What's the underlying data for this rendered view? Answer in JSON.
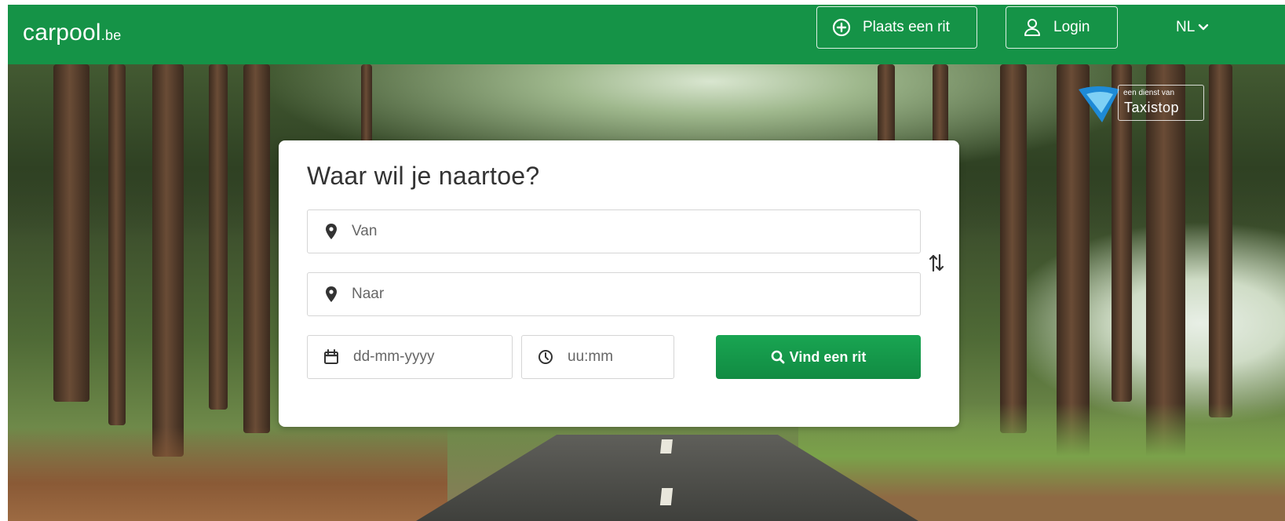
{
  "header": {
    "logo_main": "carpool",
    "logo_tld": ".be",
    "place_ride_label": "Plaats een rit",
    "login_label": "Login",
    "language": "NL",
    "brand_color": "#159347"
  },
  "badge": {
    "small_text": "een dienst van",
    "brand_text": "Taxistop"
  },
  "search": {
    "title": "Waar wil je naartoe?",
    "from_placeholder": "Van",
    "to_placeholder": "Naar",
    "date_placeholder": "dd-mm-yyyy",
    "time_placeholder": "uu:mm",
    "submit_label": "Vind een rit"
  },
  "icons": {
    "place_ride": "plus-circle-icon",
    "login": "user-icon",
    "language": "chevron-down-icon",
    "from": "map-marker-icon",
    "to": "map-marker-icon",
    "swap": "swap-vertical-icon",
    "date": "calendar-icon",
    "time": "clock-icon",
    "submit": "search-icon"
  }
}
